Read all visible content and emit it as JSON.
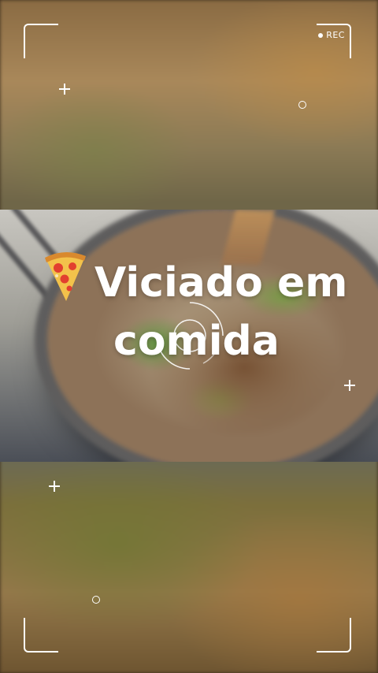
{
  "story": {
    "rec_label": "REC",
    "title_line1": "Viciado em",
    "title_line2": "comida",
    "title_emoji": "pizza-icon"
  },
  "colors": {
    "overlay_white": "#ffffff",
    "background_warm": "#8a6b43"
  }
}
